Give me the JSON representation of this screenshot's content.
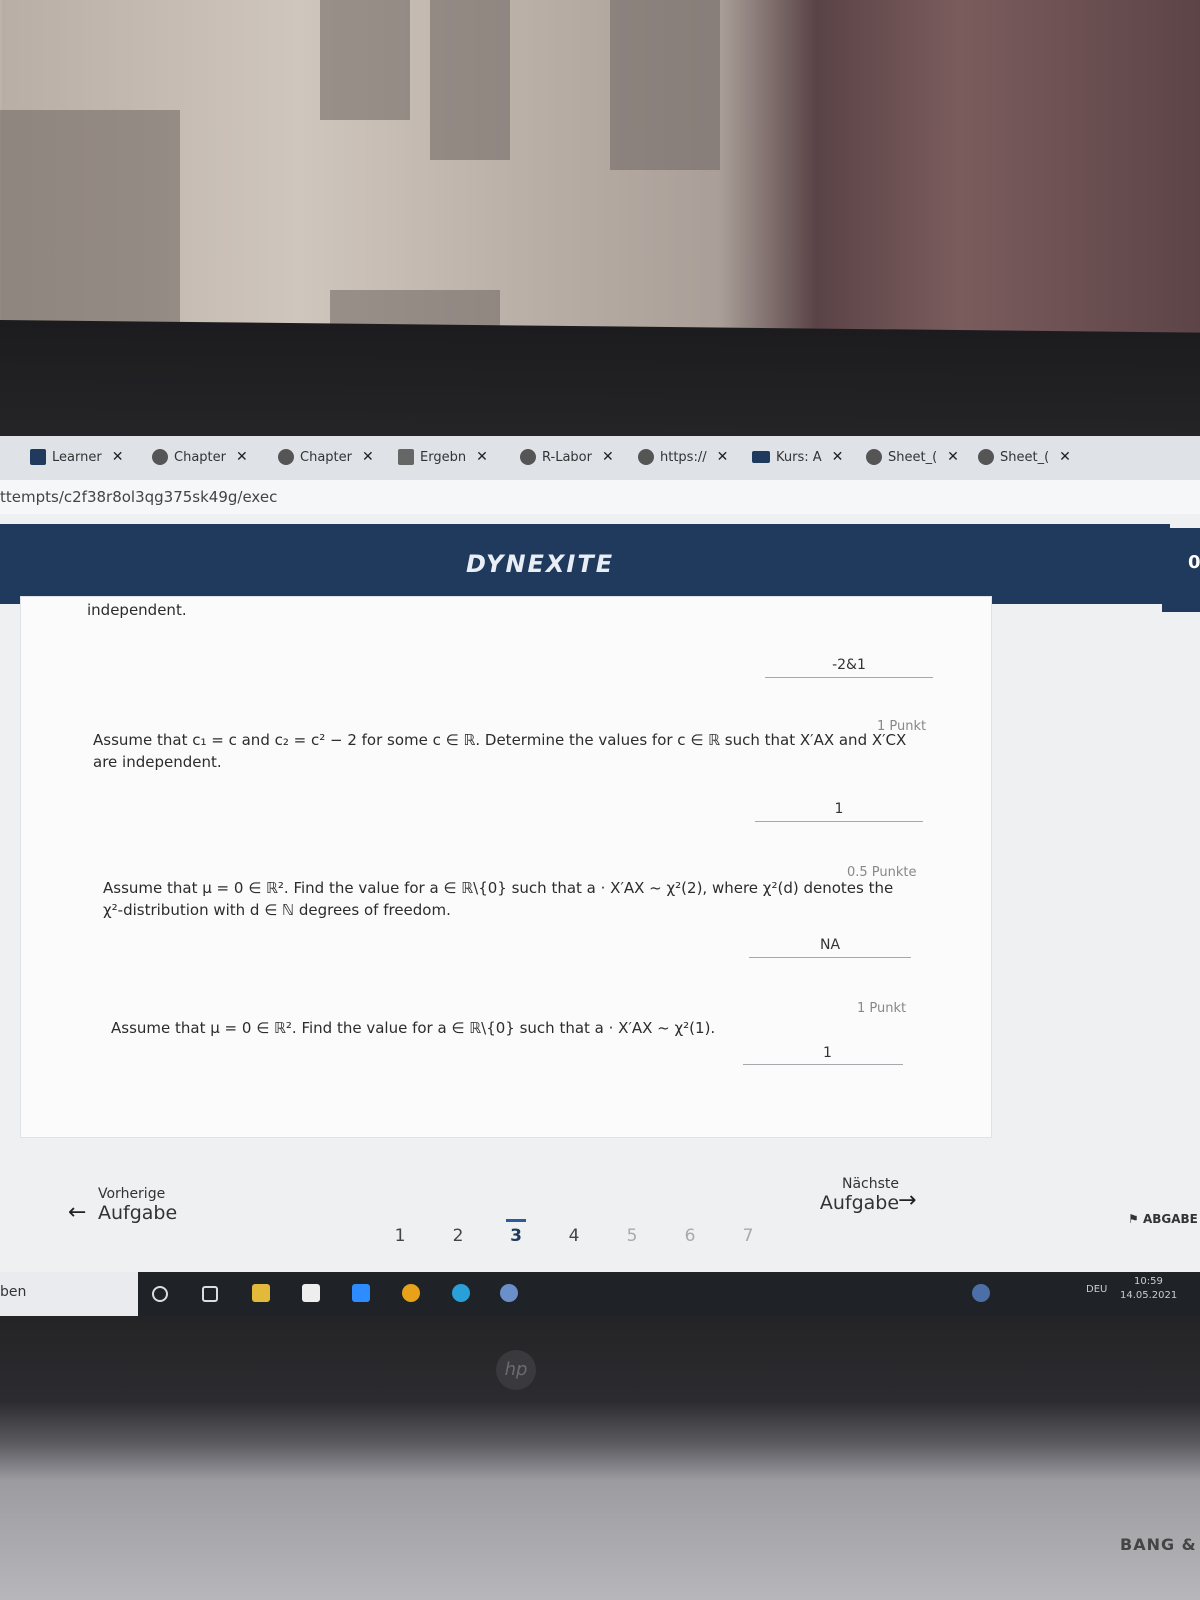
{
  "browser": {
    "tabs": [
      {
        "label": "Learner"
      },
      {
        "label": "Chapter"
      },
      {
        "label": "Chapter"
      },
      {
        "label": "Ergebn"
      },
      {
        "label": "R-Labor"
      },
      {
        "label": "https://"
      },
      {
        "label": "Kurs: A"
      },
      {
        "label": "Sheet_("
      },
      {
        "label": "Sheet_("
      }
    ],
    "new_tab": "+",
    "url": "ttempts/c2f38r8ol3qg375sk49g/exec"
  },
  "header": {
    "logo": "DYNEXITE",
    "right_text": "0"
  },
  "questions": [
    {
      "text": "independent.",
      "answer": "-2&1",
      "points": ""
    },
    {
      "points": "1 Punkt",
      "text": "Assume that c₁ = c and c₂ = c² − 2 for some c ∈ ℝ. Determine the values for c ∈ ℝ such that X′AX and X′CX are independent.",
      "answer": "1"
    },
    {
      "points": "0.5 Punkte",
      "text": "Assume that μ = 0 ∈ ℝ². Find the value for a ∈ ℝ\\{0} such that a · X′AX ~ χ²(2), where χ²(d) denotes the χ²-distribution with d ∈ ℕ degrees of freedom.",
      "answer": "NA"
    },
    {
      "points": "1 Punkt",
      "text": "Assume that μ = 0 ∈ ℝ². Find the value for a ∈ ℝ\\{0} such that a · X′AX ~ χ²(1).",
      "answer": "1"
    }
  ],
  "nav": {
    "prev_small": "Vorherige",
    "prev_big": "Aufgabe",
    "next_small": "Nächste",
    "next_big": "Aufgabe"
  },
  "pager": [
    "1",
    "2",
    "3",
    "4",
    "5",
    "6",
    "7"
  ],
  "submit_label": "ABGABE",
  "taskbar": {
    "left_text": "ben",
    "lang": "DEU",
    "time": "10:59",
    "date": "14.05.2021"
  },
  "laptop": {
    "brand": "BANG &"
  }
}
